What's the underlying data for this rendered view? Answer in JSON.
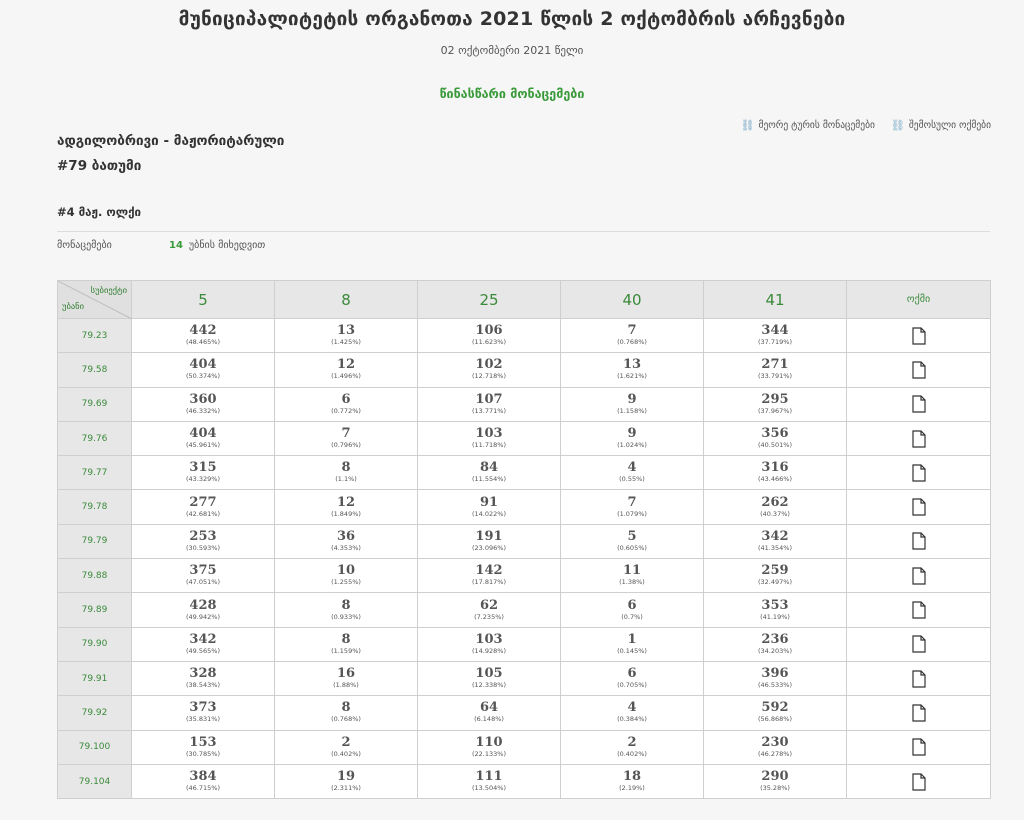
{
  "header": {
    "title": "მუნიციპალიტეტის ორგანოთა 2021 წლის 2 ოქტომბრის არჩევნები",
    "date": "02 ოქტომბერი 2021 წელი",
    "preliminary": "წინასწარი მონაცემები"
  },
  "links": [
    {
      "label": "მეორე ტურის მონაცემები",
      "icon": "link-icon"
    },
    {
      "label": "შემოსული ოქმები",
      "icon": "link-icon"
    }
  ],
  "election_type": "ადგილობრივი - მაჟორიტარული",
  "district": "#79 ბათუმი",
  "subdistrict": "#4 მაჟ. ოლქი",
  "data_row": {
    "label": "მონაცემები",
    "count": "14",
    "suffix": "უბნის მიხედვით"
  },
  "table": {
    "corner_top": "სუბიექტი",
    "corner_bottom": "უბანი",
    "columns": [
      "5",
      "8",
      "25",
      "40",
      "41"
    ],
    "docs_header": "ოქმი",
    "rows": [
      {
        "id": "79.23",
        "cells": [
          [
            "442",
            "(48.465%)"
          ],
          [
            "13",
            "(1.425%)"
          ],
          [
            "106",
            "(11.623%)"
          ],
          [
            "7",
            "(0.768%)"
          ],
          [
            "344",
            "(37.719%)"
          ]
        ]
      },
      {
        "id": "79.58",
        "cells": [
          [
            "404",
            "(50.374%)"
          ],
          [
            "12",
            "(1.496%)"
          ],
          [
            "102",
            "(12.718%)"
          ],
          [
            "13",
            "(1.621%)"
          ],
          [
            "271",
            "(33.791%)"
          ]
        ]
      },
      {
        "id": "79.69",
        "cells": [
          [
            "360",
            "(46.332%)"
          ],
          [
            "6",
            "(0.772%)"
          ],
          [
            "107",
            "(13.771%)"
          ],
          [
            "9",
            "(1.158%)"
          ],
          [
            "295",
            "(37.967%)"
          ]
        ]
      },
      {
        "id": "79.76",
        "cells": [
          [
            "404",
            "(45.961%)"
          ],
          [
            "7",
            "(0.796%)"
          ],
          [
            "103",
            "(11.718%)"
          ],
          [
            "9",
            "(1.024%)"
          ],
          [
            "356",
            "(40.501%)"
          ]
        ]
      },
      {
        "id": "79.77",
        "cells": [
          [
            "315",
            "(43.329%)"
          ],
          [
            "8",
            "(1.1%)"
          ],
          [
            "84",
            "(11.554%)"
          ],
          [
            "4",
            "(0.55%)"
          ],
          [
            "316",
            "(43.466%)"
          ]
        ]
      },
      {
        "id": "79.78",
        "cells": [
          [
            "277",
            "(42.681%)"
          ],
          [
            "12",
            "(1.849%)"
          ],
          [
            "91",
            "(14.022%)"
          ],
          [
            "7",
            "(1.079%)"
          ],
          [
            "262",
            "(40.37%)"
          ]
        ]
      },
      {
        "id": "79.79",
        "cells": [
          [
            "253",
            "(30.593%)"
          ],
          [
            "36",
            "(4.353%)"
          ],
          [
            "191",
            "(23.096%)"
          ],
          [
            "5",
            "(0.605%)"
          ],
          [
            "342",
            "(41.354%)"
          ]
        ]
      },
      {
        "id": "79.88",
        "cells": [
          [
            "375",
            "(47.051%)"
          ],
          [
            "10",
            "(1.255%)"
          ],
          [
            "142",
            "(17.817%)"
          ],
          [
            "11",
            "(1.38%)"
          ],
          [
            "259",
            "(32.497%)"
          ]
        ]
      },
      {
        "id": "79.89",
        "cells": [
          [
            "428",
            "(49.942%)"
          ],
          [
            "8",
            "(0.933%)"
          ],
          [
            "62",
            "(7.235%)"
          ],
          [
            "6",
            "(0.7%)"
          ],
          [
            "353",
            "(41.19%)"
          ]
        ]
      },
      {
        "id": "79.90",
        "cells": [
          [
            "342",
            "(49.565%)"
          ],
          [
            "8",
            "(1.159%)"
          ],
          [
            "103",
            "(14.928%)"
          ],
          [
            "1",
            "(0.145%)"
          ],
          [
            "236",
            "(34.203%)"
          ]
        ]
      },
      {
        "id": "79.91",
        "cells": [
          [
            "328",
            "(38.543%)"
          ],
          [
            "16",
            "(1.88%)"
          ],
          [
            "105",
            "(12.338%)"
          ],
          [
            "6",
            "(0.705%)"
          ],
          [
            "396",
            "(46.533%)"
          ]
        ]
      },
      {
        "id": "79.92",
        "cells": [
          [
            "373",
            "(35.831%)"
          ],
          [
            "8",
            "(0.768%)"
          ],
          [
            "64",
            "(6.148%)"
          ],
          [
            "4",
            "(0.384%)"
          ],
          [
            "592",
            "(56.868%)"
          ]
        ]
      },
      {
        "id": "79.100",
        "cells": [
          [
            "153",
            "(30.785%)"
          ],
          [
            "2",
            "(0.402%)"
          ],
          [
            "110",
            "(22.133%)"
          ],
          [
            "2",
            "(0.402%)"
          ],
          [
            "230",
            "(46.278%)"
          ]
        ]
      },
      {
        "id": "79.104",
        "cells": [
          [
            "384",
            "(46.715%)"
          ],
          [
            "19",
            "(2.311%)"
          ],
          [
            "111",
            "(13.504%)"
          ],
          [
            "18",
            "(2.19%)"
          ],
          [
            "290",
            "(35.28%)"
          ]
        ]
      }
    ]
  },
  "colors": {
    "accent_green": "#3a9a3a",
    "header_gray": "#e7e7e7",
    "link_blue": "#7aaac9"
  }
}
